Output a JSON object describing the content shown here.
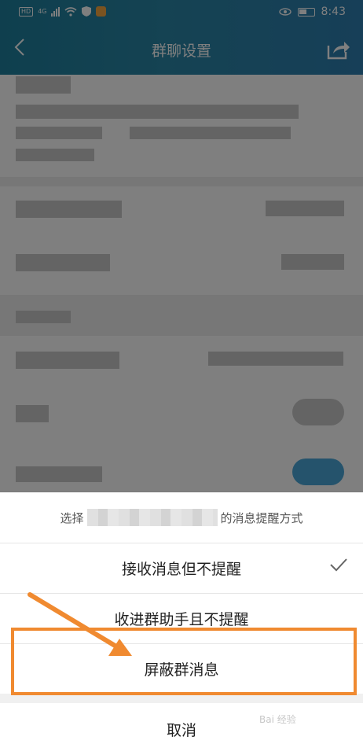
{
  "status_bar": {
    "hd": "HD",
    "network": "4G",
    "time": "8:43"
  },
  "nav": {
    "title": "群聊设置"
  },
  "sheet": {
    "title_prefix": "选择",
    "title_suffix": "的消息提醒方式",
    "options": [
      {
        "label": "接收消息但不提醒",
        "selected": true
      },
      {
        "label": "收进群助手且不提醒",
        "selected": false
      },
      {
        "label": "屏蔽群消息",
        "selected": false
      }
    ],
    "cancel": "取消"
  },
  "annotation": {
    "highlight_color": "#f08a30",
    "highlighted_option": "屏蔽群消息"
  },
  "colors": {
    "nav_bg": "#2a86a6",
    "overlay": "rgba(0,0,0,0.5)"
  },
  "icons": [
    "back-icon",
    "share-icon",
    "check-icon",
    "eye-icon",
    "battery-icon",
    "wifi-icon",
    "signal-icon"
  ]
}
